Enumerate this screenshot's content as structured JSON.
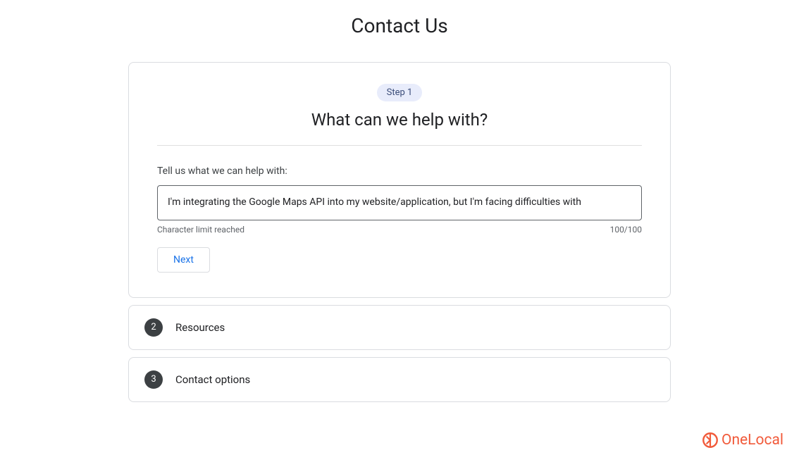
{
  "page_title": "Contact Us",
  "step1": {
    "badge": "Step 1",
    "heading": "What can we help with?",
    "field_label": "Tell us what we can help with:",
    "input_value": "I'm integrating the Google Maps API into my website/application, but I'm facing difficulties with",
    "limit_message": "Character limit reached",
    "char_count": "100/100",
    "next_label": "Next"
  },
  "sections": [
    {
      "number": "2",
      "label": "Resources"
    },
    {
      "number": "3",
      "label": "Contact options"
    }
  ],
  "watermark": "OneLocal"
}
